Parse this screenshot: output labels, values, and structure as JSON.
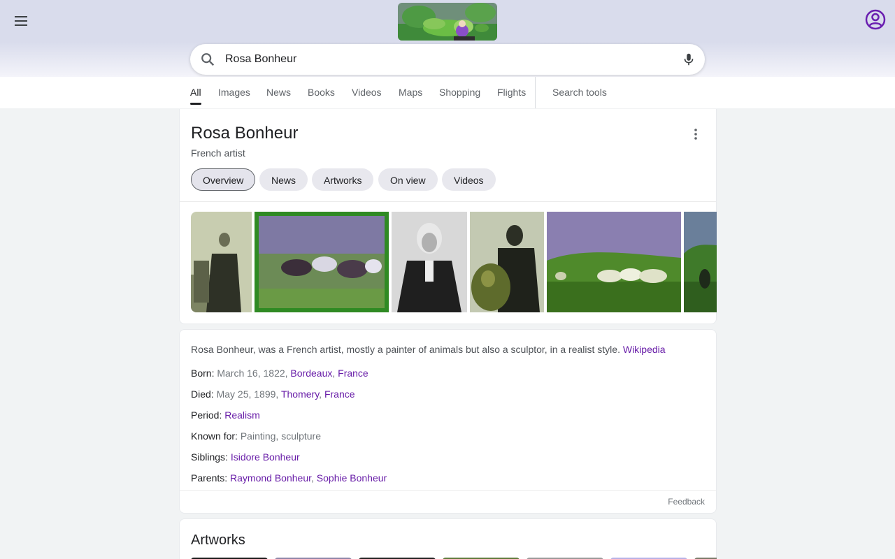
{
  "header": {
    "doodle_alt": "Rosa Bonheur doodle"
  },
  "search": {
    "query": "Rosa Bonheur"
  },
  "tabs": [
    {
      "label": "All"
    },
    {
      "label": "Images"
    },
    {
      "label": "News"
    },
    {
      "label": "Books"
    },
    {
      "label": "Videos"
    },
    {
      "label": "Maps"
    },
    {
      "label": "Shopping"
    },
    {
      "label": "Flights"
    },
    {
      "label": "Search tools"
    }
  ],
  "knowledge_panel": {
    "title": "Rosa Bonheur",
    "subtitle": "French artist",
    "chips": [
      {
        "label": "Overview"
      },
      {
        "label": "News"
      },
      {
        "label": "Artworks"
      },
      {
        "label": "On view"
      },
      {
        "label": "Videos"
      }
    ],
    "description": "Rosa Bonheur, was a French artist, mostly a painter of animals but also a sculptor, in a realist style.",
    "description_source": "Wikipedia",
    "facts": {
      "born": {
        "label": "Born:",
        "value": "March 16, 1822,",
        "link1": "Bordeaux",
        "sep": ",",
        "link2": "France"
      },
      "died": {
        "label": "Died:",
        "value": "May 25, 1899,",
        "link1": "Thomery",
        "sep": ",",
        "link2": "France"
      },
      "period": {
        "label": "Period:",
        "link1": "Realism"
      },
      "known_for": {
        "label": "Known for:",
        "value": "Painting, sculpture"
      },
      "siblings": {
        "label": "Siblings:",
        "link1": "Isidore Bonheur"
      },
      "parents": {
        "label": "Parents:",
        "link1": "Raymond Bonheur",
        "sep": ",",
        "link2": "Sophie Bonheur"
      }
    },
    "feedback": "Feedback"
  },
  "artworks": {
    "title": "Artworks"
  },
  "colors": {
    "link": "#681da8",
    "header_bg": "#d9dcec",
    "account_icon": "#6a1fb0"
  }
}
